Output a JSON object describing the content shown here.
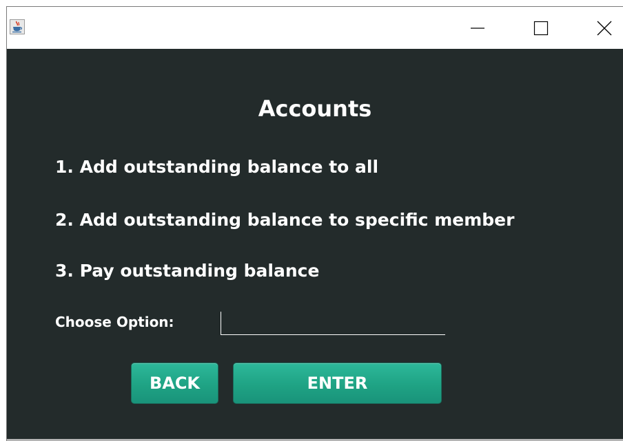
{
  "window": {
    "controls": {
      "minimize_icon": "minimize-icon",
      "maximize_icon": "maximize-icon",
      "close_icon": "close-icon"
    },
    "app_icon": "java-cup-icon"
  },
  "page": {
    "title": "Accounts",
    "options": [
      "1. Add outstanding balance to all",
      "2. Add outstanding balance to specific member",
      "3. Pay outstanding balance"
    ],
    "choose_label": "Choose Option:",
    "choose_value": "",
    "back_label": "BACK",
    "enter_label": "ENTER"
  },
  "colors": {
    "background": "#232b2b",
    "text": "#ffffff",
    "button": "#1fa384"
  }
}
